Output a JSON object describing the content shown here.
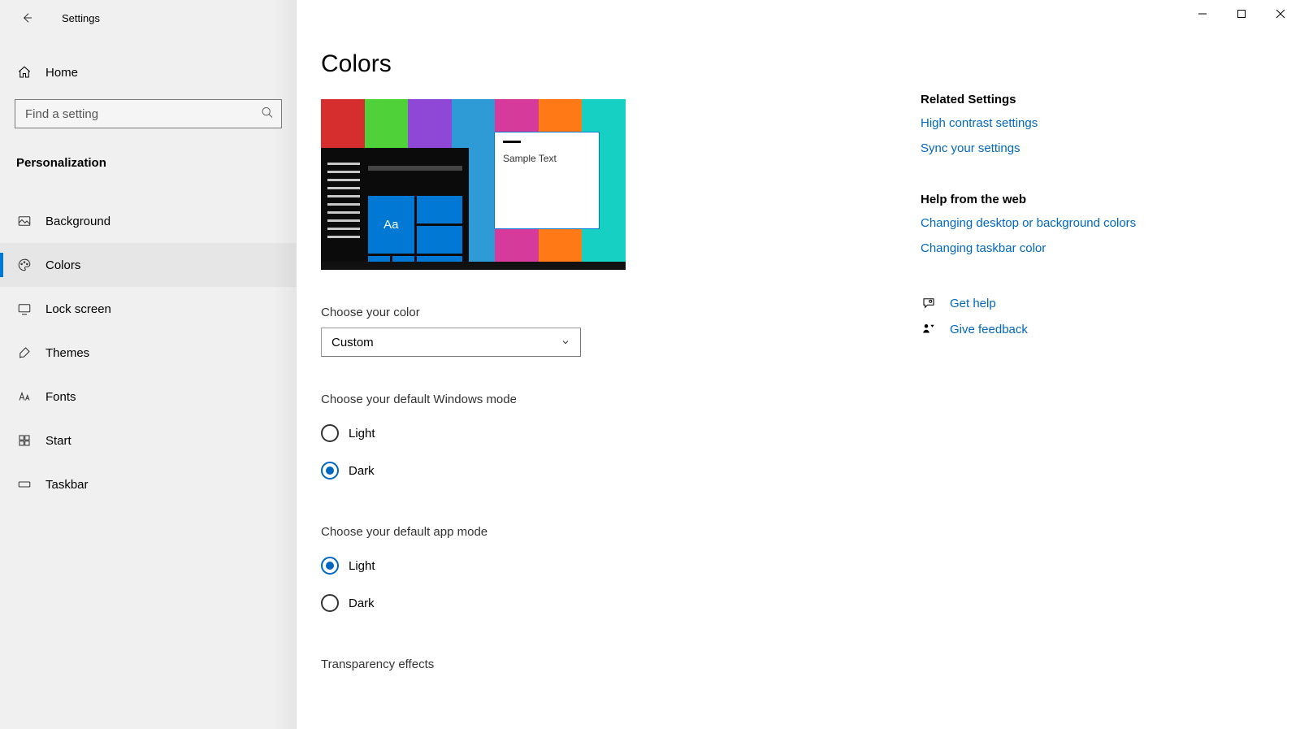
{
  "appTitle": "Settings",
  "home": {
    "label": "Home"
  },
  "search": {
    "placeholder": "Find a setting"
  },
  "sectionTitle": "Personalization",
  "nav": [
    {
      "label": "Background"
    },
    {
      "label": "Colors"
    },
    {
      "label": "Lock screen"
    },
    {
      "label": "Themes"
    },
    {
      "label": "Fonts"
    },
    {
      "label": "Start"
    },
    {
      "label": "Taskbar"
    }
  ],
  "activeNavIndex": 1,
  "pageTitle": "Colors",
  "preview": {
    "sampleText": "Sample Text",
    "tileGlyph": "Aa"
  },
  "colorMode": {
    "label": "Choose your color",
    "selected": "Custom"
  },
  "windowsMode": {
    "label": "Choose your default Windows mode",
    "options": [
      "Light",
      "Dark"
    ],
    "selected": "Dark"
  },
  "appMode": {
    "label": "Choose your default app mode",
    "options": [
      "Light",
      "Dark"
    ],
    "selected": "Light"
  },
  "transparency": {
    "label": "Transparency effects"
  },
  "related": {
    "heading": "Related Settings",
    "links": [
      "High contrast settings",
      "Sync your settings"
    ]
  },
  "helpWeb": {
    "heading": "Help from the web",
    "links": [
      "Changing desktop or background colors",
      "Changing taskbar color"
    ]
  },
  "support": {
    "getHelp": "Get help",
    "giveFeedback": "Give feedback"
  }
}
